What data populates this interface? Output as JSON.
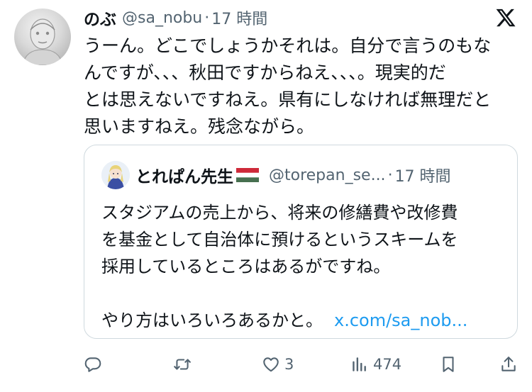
{
  "tweet": {
    "author_name": "のぶ",
    "handle": "@sa_nobu",
    "separator": "·",
    "time": "17 時間",
    "text_lines": [
      "うーん。どこでしょうかそれは。自分で言うのもな",
      "んですが、、、秋田ですからねえ、、、。現実的だ",
      "とは思えないですねえ。県有にしなければ無理だと",
      "思いますねえ。残念ながら。"
    ]
  },
  "quote": {
    "author_name": "とれぱん先生",
    "handle": "@torepan_se...",
    "separator": "·",
    "time": "17 時間",
    "text_lines": [
      "スタジアムの売上から、将来の修繕費や改修費",
      "を基金として自治体に預けるというスキームを",
      "採用しているところはあるがですね。",
      ""
    ],
    "last_line": "やり方はいろいろあるかと。",
    "link_text": "x.com/sa_nob..."
  },
  "actions": {
    "reply_icon": "reply-icon",
    "retweet_icon": "retweet-icon",
    "like_icon": "heart-icon",
    "like_count": "3",
    "views_icon": "views-icon",
    "views_count": "474",
    "bookmark_icon": "bookmark-icon",
    "share_icon": "share-icon"
  },
  "colors": {
    "text": "#0f1419",
    "secondary": "#536471",
    "link": "#1d9bf0",
    "border": "#cfd9de"
  }
}
